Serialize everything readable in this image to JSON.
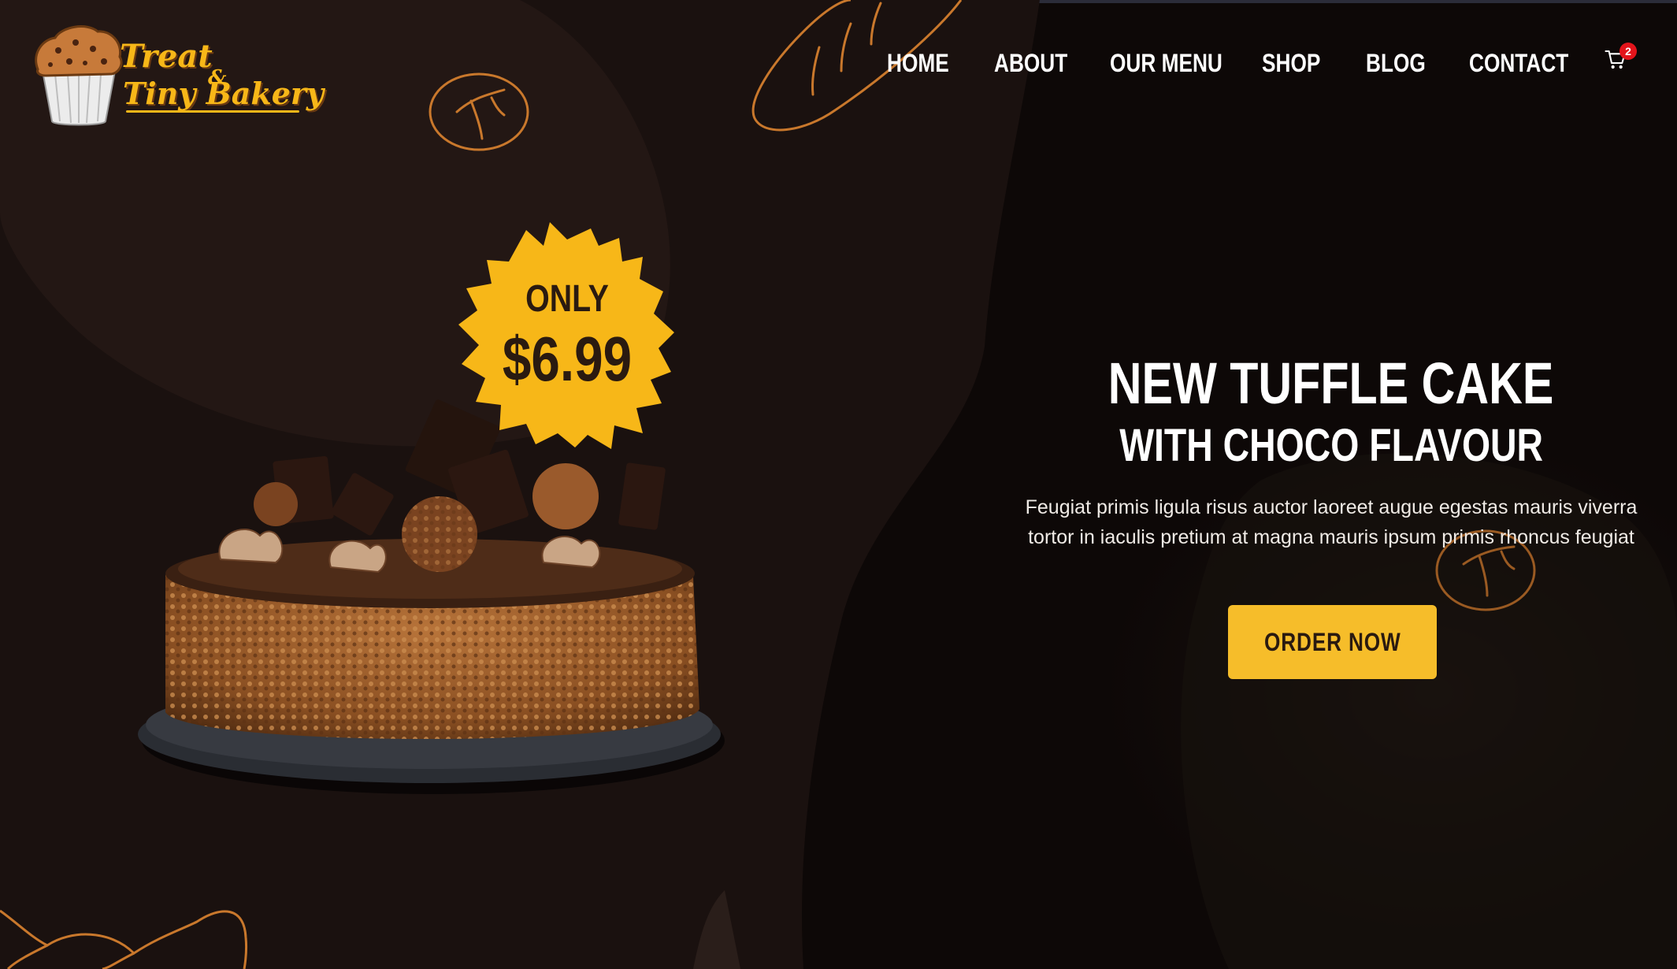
{
  "brand": {
    "line1": "Treat",
    "ampersand": "&",
    "line2": "Tiny Bakery",
    "logo_icon": "muffin-icon",
    "accent": "#f7b718"
  },
  "nav": {
    "items": [
      {
        "label": "HOME"
      },
      {
        "label": "ABOUT"
      },
      {
        "label": "OUR MENU"
      },
      {
        "label": "SHOP"
      },
      {
        "label": "BLOG"
      },
      {
        "label": "CONTACT"
      }
    ],
    "cart_icon": "shopping-cart-icon",
    "cart_count": "2"
  },
  "promo": {
    "prefix": "ONLY",
    "price": "$6.99",
    "badge_color": "#f7b718"
  },
  "hero": {
    "title_line1": "NEW TUFFLE CAKE",
    "title_line2": "WITH CHOCO FLAVOUR",
    "description": "Feugiat primis ligula risus auctor laoreet augue egestas mauris viverra tortor in iaculis pretium at magna mauris ipsum primis rhoncus feugiat",
    "cta_label": "ORDER NOW",
    "cta_color": "#f6bd2a",
    "image": "chocolate-truffle-cake"
  },
  "colors": {
    "background": "#0d0807",
    "doodle": "#c9782c"
  }
}
